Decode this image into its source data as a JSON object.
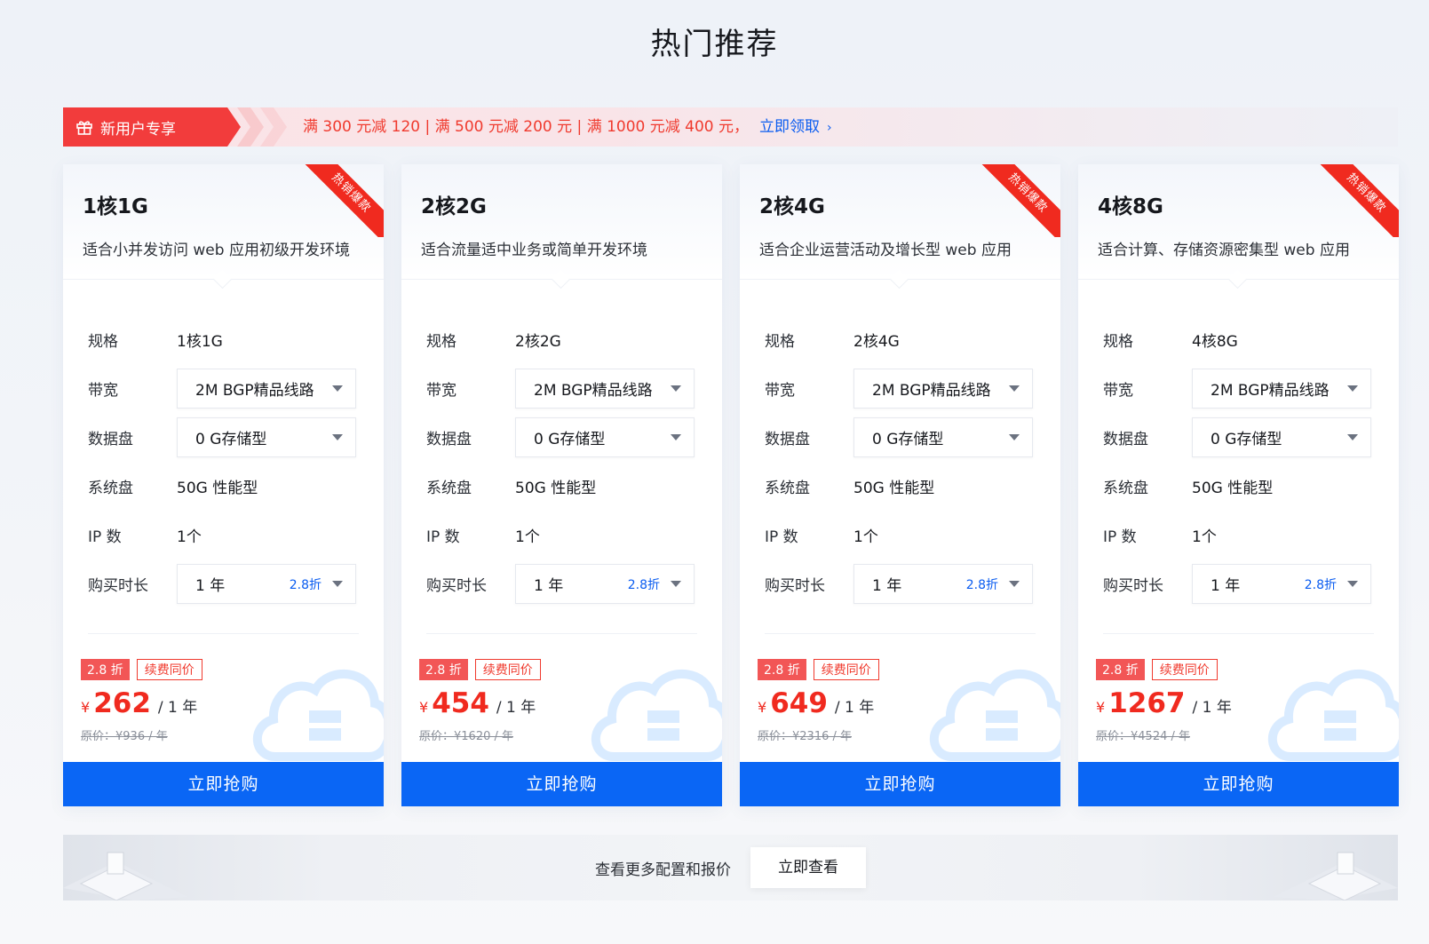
{
  "page_title": "热门推荐",
  "promo": {
    "tag_label": "新用户专享",
    "offer_text": "满 300 元减 120 | 满 500 元减 200 元 | 满 1000 元减 400 元，",
    "link_label": "立即领取",
    "link_arrow": "›"
  },
  "labels": {
    "spec": "规格",
    "bandwidth": "带宽",
    "data_disk": "数据盘",
    "system_disk": "系统盘",
    "ip_count": "IP 数",
    "duration": "购买时长"
  },
  "cards": [
    {
      "name": "1核1G",
      "desc": "适合小并发访问 web 应用初级开发环境",
      "hot_ribbon": "热销爆款",
      "spec": "1核1G",
      "bandwidth": "2M BGP精品线路",
      "data_disk": "0 G存储型",
      "system_disk": "50G 性能型",
      "ip_count": "1个",
      "duration": "1 年",
      "duration_discount": "2.8折",
      "discount_badge": "2.8 折",
      "renew_badge": "续费同价",
      "currency": "¥",
      "price": "262",
      "per": "/ 1 年",
      "original": "原价：¥936 / 年",
      "buy_label": "立即抢购"
    },
    {
      "name": "2核2G",
      "desc": "适合流量适中业务或简单开发环境",
      "hot_ribbon": "",
      "spec": "2核2G",
      "bandwidth": "2M BGP精品线路",
      "data_disk": "0 G存储型",
      "system_disk": "50G 性能型",
      "ip_count": "1个",
      "duration": "1 年",
      "duration_discount": "2.8折",
      "discount_badge": "2.8 折",
      "renew_badge": "续费同价",
      "currency": "¥",
      "price": "454",
      "per": "/ 1 年",
      "original": "原价：¥1620 / 年",
      "buy_label": "立即抢购"
    },
    {
      "name": "2核4G",
      "desc": "适合企业运营活动及增长型 web 应用",
      "hot_ribbon": "热销爆款",
      "spec": "2核4G",
      "bandwidth": "2M BGP精品线路",
      "data_disk": "0 G存储型",
      "system_disk": "50G 性能型",
      "ip_count": "1个",
      "duration": "1 年",
      "duration_discount": "2.8折",
      "discount_badge": "2.8 折",
      "renew_badge": "续费同价",
      "currency": "¥",
      "price": "649",
      "per": "/ 1 年",
      "original": "原价：¥2316 / 年",
      "buy_label": "立即抢购"
    },
    {
      "name": "4核8G",
      "desc": "适合计算、存储资源密集型 web 应用",
      "hot_ribbon": "热销爆款",
      "spec": "4核8G",
      "bandwidth": "2M BGP精品线路",
      "data_disk": "0 G存储型",
      "system_disk": "50G 性能型",
      "ip_count": "1个",
      "duration": "1 年",
      "duration_discount": "2.8折",
      "discount_badge": "2.8 折",
      "renew_badge": "续费同价",
      "currency": "¥",
      "price": "1267",
      "per": "/ 1 年",
      "original": "原价：¥4524 / 年",
      "buy_label": "立即抢购"
    }
  ],
  "more": {
    "text": "查看更多配置和报价",
    "button_label": "立即查看"
  },
  "colors": {
    "accent_blue": "#0a66f5",
    "price_red": "#f02a1f",
    "promo_red": "#f23c3c"
  }
}
